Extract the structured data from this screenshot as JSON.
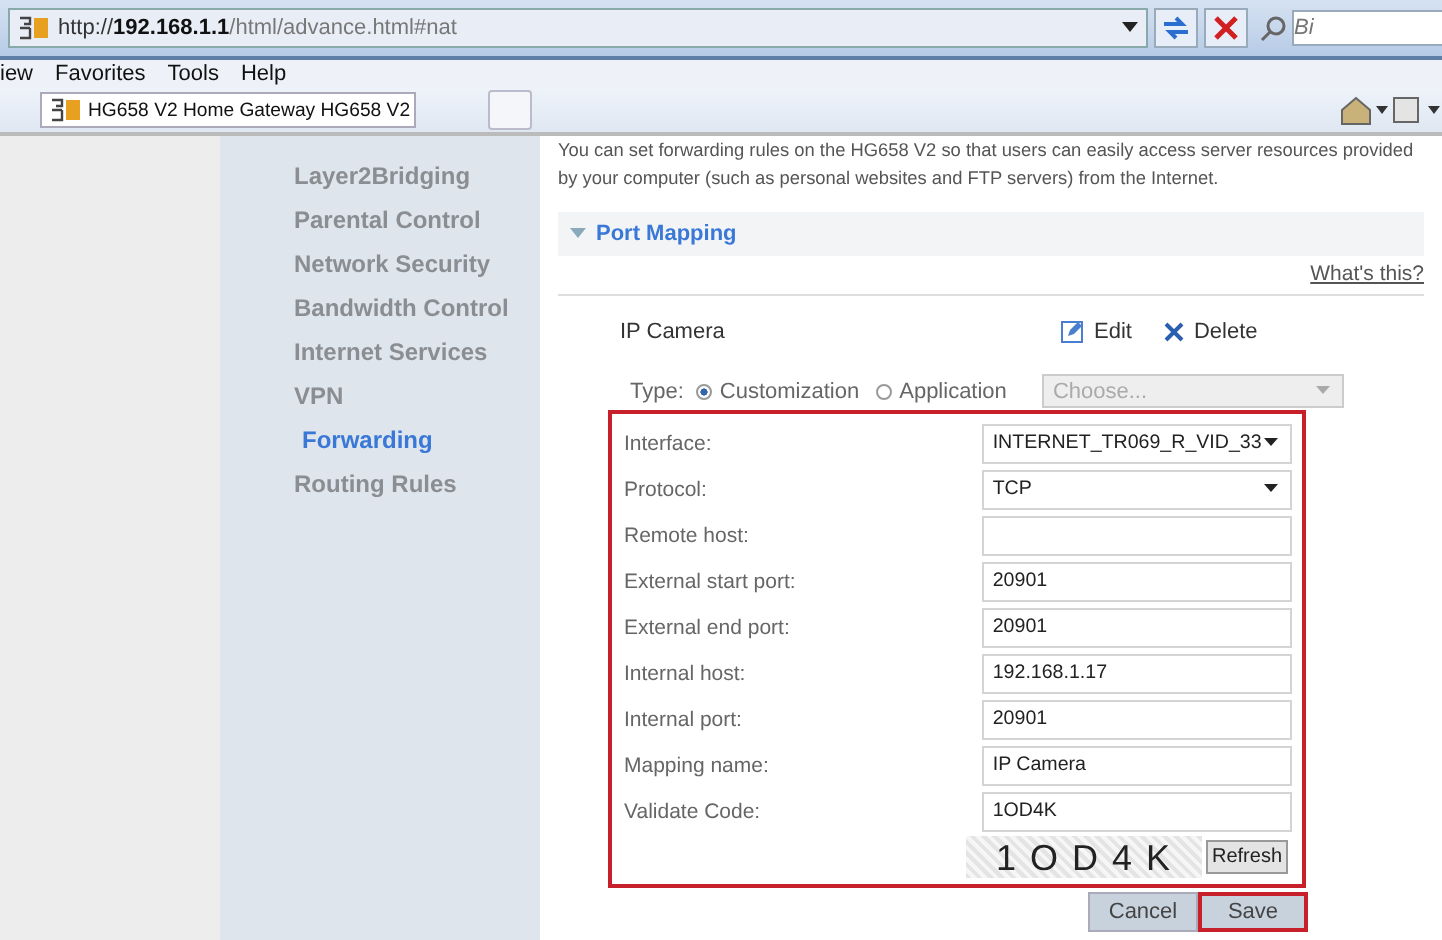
{
  "browser": {
    "address": {
      "scheme": "http://",
      "host": "192.168.1.1",
      "path": "/html/advance.html#nat"
    },
    "search": {
      "placeholder": "Bi"
    },
    "menu": [
      "iew",
      "Favorites",
      "Tools",
      "Help"
    ],
    "tab": {
      "title": "HG658 V2 Home Gateway HG658 V2"
    }
  },
  "sidebar": {
    "items": [
      {
        "label": "Layer2Bridging",
        "selected": false
      },
      {
        "label": "Parental Control",
        "selected": false
      },
      {
        "label": "Network Security",
        "selected": false
      },
      {
        "label": "Bandwidth Control",
        "selected": false
      },
      {
        "label": "Internet Services",
        "selected": false
      },
      {
        "label": "VPN",
        "selected": false
      },
      {
        "label": "Forwarding",
        "selected": true
      },
      {
        "label": "Routing Rules",
        "selected": false
      }
    ]
  },
  "intro": "You can set forwarding rules on the HG658 V2 so that users can easily access server resources provided by your computer (such as personal websites and FTP servers) from the Internet.",
  "section": {
    "title": "Port Mapping",
    "expanded": true,
    "help_link": "What's this?"
  },
  "entry": {
    "name": "IP Camera",
    "edit": "Edit",
    "delete": "Delete"
  },
  "type_row": {
    "label": "Type:",
    "options": [
      {
        "label": "Customization",
        "selected": true
      },
      {
        "label": "Application",
        "selected": false
      }
    ],
    "app_select": {
      "placeholder": "Choose...",
      "disabled": true
    }
  },
  "form": {
    "highlighted": true,
    "fields": [
      {
        "kind": "select",
        "label": "Interface:",
        "value": "INTERNET_TR069_R_VID_33"
      },
      {
        "kind": "select",
        "label": "Protocol:",
        "value": "TCP"
      },
      {
        "kind": "text",
        "label": "Remote host:"
      },
      {
        "kind": "text",
        "label": "External start port:",
        "value": "20901"
      },
      {
        "kind": "text",
        "label": "External end port:",
        "value": "20901"
      },
      {
        "kind": "text",
        "label": "Internal host:",
        "value": "192.168.1.17"
      },
      {
        "kind": "text",
        "label": "Internal port:",
        "value": "20901"
      },
      {
        "kind": "text",
        "label": "Mapping name:",
        "value": "IP Camera"
      },
      {
        "kind": "text",
        "label": "Validate Code:",
        "value": "1OD4K"
      }
    ],
    "captcha": "1 O D 4 K",
    "refresh": "Refresh"
  },
  "buttons": [
    {
      "label": "Cancel",
      "highlighted": false
    },
    {
      "label": "Save",
      "highlighted": true
    }
  ]
}
